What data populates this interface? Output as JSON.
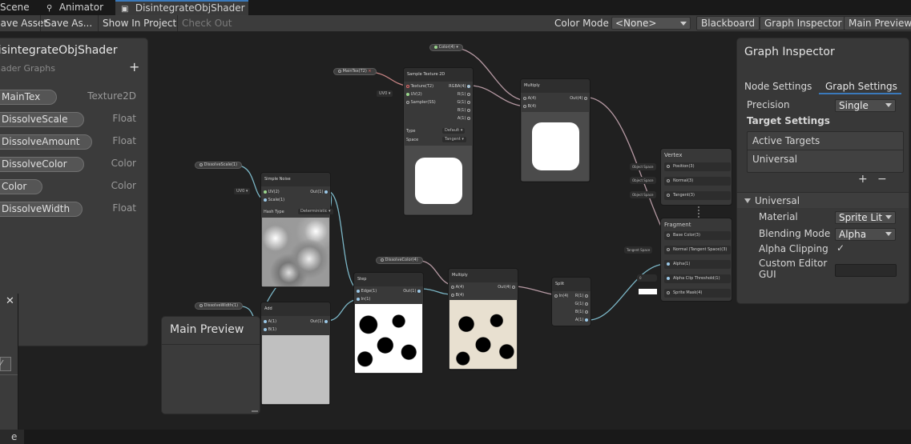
{
  "tabs": [
    "Scene",
    "Animator",
    "DisintegrateObjShader"
  ],
  "toolbar": {
    "save_asset": "Save Asset",
    "save_as": "Save As...",
    "show_in_project": "Show In Project",
    "check_out": "Check Out",
    "color_mode_label": "Color Mode",
    "color_mode_value": "<None>",
    "blackboard": "Blackboard",
    "graph_inspector": "Graph Inspector",
    "main_preview": "Main Preview"
  },
  "blackboard": {
    "title": "DisintegrateObjShader",
    "subtitle": "Shader Graphs",
    "add": "+",
    "properties": [
      {
        "name": "MainTex",
        "type": "Texture2D"
      },
      {
        "name": "DissolveScale",
        "type": "Float"
      },
      {
        "name": "DissolveAmount",
        "type": "Float"
      },
      {
        "name": "DissolveColor",
        "type": "Color"
      },
      {
        "name": "Color",
        "type": "Color"
      },
      {
        "name": "DissolveWidth",
        "type": "Float"
      }
    ]
  },
  "main_preview": {
    "title": "Main Preview"
  },
  "inspector": {
    "title": "Graph Inspector",
    "tabs": [
      "Node Settings",
      "Graph Settings"
    ],
    "precision_label": "Precision",
    "precision_value": "Single",
    "target_settings": "Target Settings",
    "active_targets": "Active Targets",
    "target_item": "Universal",
    "add": "+",
    "remove": "−",
    "section": "Universal",
    "material_label": "Material",
    "material_value": "Sprite Lit",
    "blending_label": "Blending Mode",
    "blending_value": "Alpha",
    "alpha_clip_label": "Alpha Clipping",
    "alpha_clip_check": "✓",
    "custom_gui_label": "Custom Editor GUI"
  },
  "nodes": {
    "sample_texture": {
      "title": "Sample Texture 2D",
      "inputs": [
        "Texture(T2)",
        "UV(2)",
        "Sampler(SS)"
      ],
      "outputs": [
        "RGBA(4)",
        "R(1)",
        "G(1)",
        "B(1)",
        "A(1)"
      ],
      "type_label": "Type",
      "type_value": "Default",
      "space_label": "Space",
      "space_value": "Tangent"
    },
    "multiply_top": {
      "title": "Multiply",
      "inputs": [
        "A(4)",
        "B(4)"
      ],
      "output": "Out(4)"
    },
    "simple_noise": {
      "title": "Simple Noise",
      "inputs": [
        "UV(2)",
        "Scale(1)"
      ],
      "output": "Out(1)",
      "hash_label": "Hash Type",
      "hash_value": "Deterministic"
    },
    "add": {
      "title": "Add",
      "inputs": [
        "A(1)",
        "B(1)"
      ],
      "output": "Out(1)"
    },
    "step": {
      "title": "Step",
      "inputs": [
        "Edge(1)",
        "In(1)"
      ],
      "output": "Out(1)"
    },
    "multiply_mid": {
      "title": "Multiply",
      "inputs": [
        "A(4)",
        "B(4)"
      ],
      "output": "Out(4)"
    },
    "split": {
      "title": "Split",
      "input": "In(4)",
      "outputs": [
        "R(1)",
        "G(1)",
        "B(1)",
        "A(1)"
      ]
    },
    "vertex": {
      "title": "Vertex",
      "slots": [
        "Position(3)",
        "Normal(3)",
        "Tangent(3)"
      ],
      "badges": [
        "Object Space",
        "Object Space",
        "Object Space"
      ]
    },
    "fragment": {
      "title": "Fragment",
      "slots": [
        "Base Color(3)",
        "Normal (Tangent Space)(3)",
        "Alpha(1)",
        "Alpha Clip Threshold(1)",
        "Sprite Mask(4)"
      ],
      "badges": [
        "Tangent Space",
        "0"
      ]
    }
  },
  "chips": {
    "color": "Color(4)",
    "maintex": "MainTex(T2)",
    "uv0a": "UV0",
    "uv0b": "UV0",
    "dissolve_scale": "DissolveScale(1)",
    "dissolve_color": "DissolveColor(4)",
    "dissolve_width": "DissolveWidth(1)"
  },
  "bottom": {
    "label": "e"
  }
}
